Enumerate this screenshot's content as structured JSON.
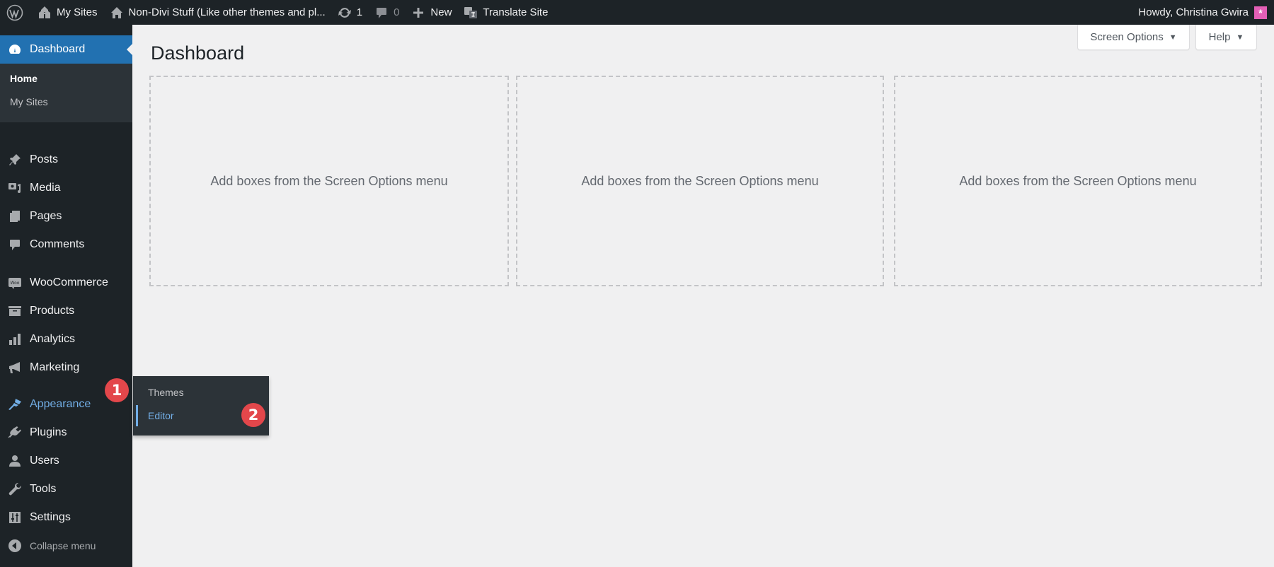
{
  "admin_bar": {
    "wp_logo_icon": "wordpress-logo-icon",
    "my_sites": "My Sites",
    "site_name": "Non-Divi Stuff (Like other themes and pl...",
    "updates_count": "1",
    "comments_count": "0",
    "new_label": "New",
    "translate_label": "Translate Site",
    "greeting": "Howdy, Christina Gwira",
    "avatar_glyph": "*"
  },
  "sidebar": {
    "dashboard": "Dashboard",
    "submenu": [
      "Home",
      "My Sites"
    ],
    "items": [
      {
        "label": "Posts",
        "icon": "pin-icon"
      },
      {
        "label": "Media",
        "icon": "media-icon"
      },
      {
        "label": "Pages",
        "icon": "pages-icon"
      },
      {
        "label": "Comments",
        "icon": "comment-icon"
      },
      {
        "label": "WooCommerce",
        "icon": "woo-icon"
      },
      {
        "label": "Products",
        "icon": "archive-icon"
      },
      {
        "label": "Analytics",
        "icon": "bar-chart-icon"
      },
      {
        "label": "Marketing",
        "icon": "megaphone-icon"
      },
      {
        "label": "Appearance",
        "icon": "brush-icon"
      },
      {
        "label": "Plugins",
        "icon": "plugin-icon"
      },
      {
        "label": "Users",
        "icon": "user-icon"
      },
      {
        "label": "Tools",
        "icon": "wrench-icon"
      },
      {
        "label": "Settings",
        "icon": "settings-icon"
      }
    ],
    "collapse": "Collapse menu"
  },
  "flyout": {
    "items": [
      "Themes",
      "Editor"
    ]
  },
  "annotations": {
    "badge1": "1",
    "badge2": "2",
    "color": "#e3474b"
  },
  "main": {
    "title": "Dashboard",
    "screen_options": "Screen Options",
    "help": "Help",
    "caret": "▼",
    "placeholder": "Add boxes from the Screen Options menu"
  },
  "colors": {
    "admin_bg": "#1d2327",
    "accent": "#2271b1",
    "hover_link": "#72aee6",
    "page_bg": "#f0f0f1"
  }
}
